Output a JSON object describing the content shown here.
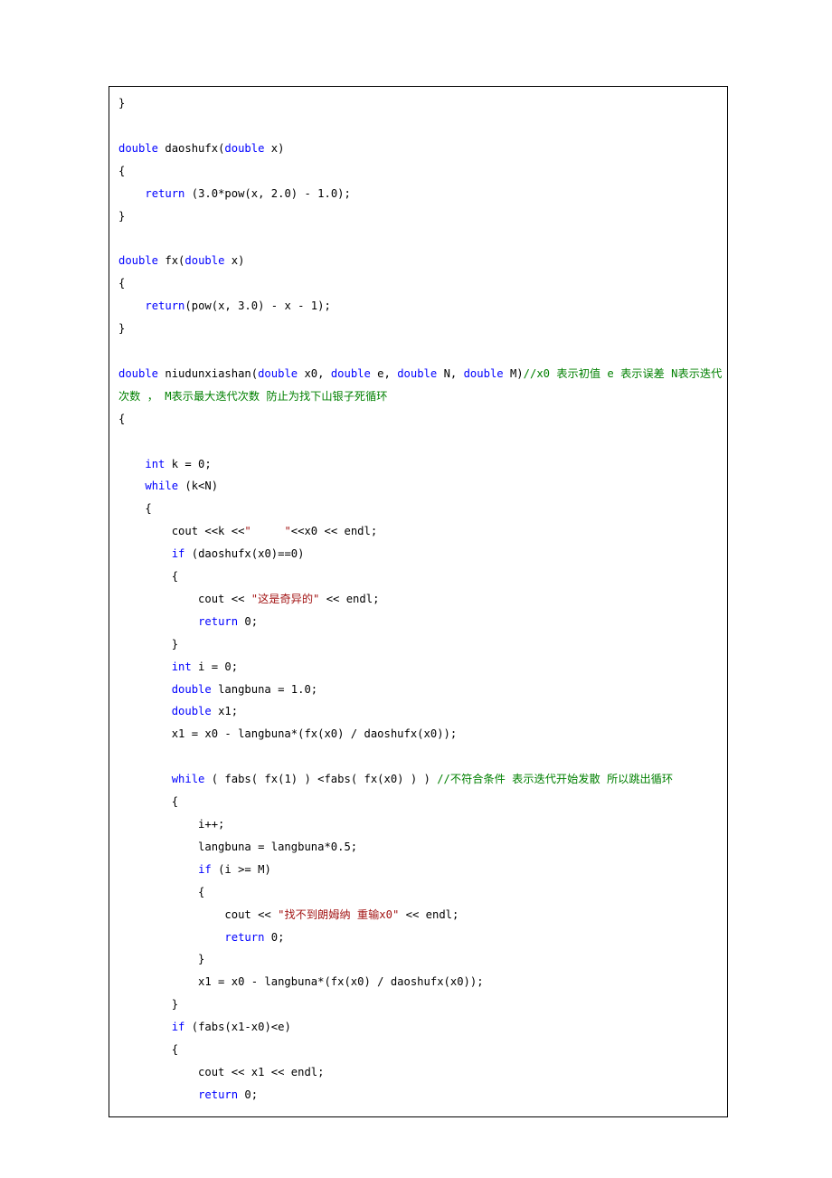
{
  "code": {
    "lines": [
      [
        {
          "t": "}",
          "c": ""
        }
      ],
      [
        {
          "t": "",
          "c": ""
        }
      ],
      [
        {
          "t": "double",
          "c": "kw"
        },
        {
          "t": " daoshufx(",
          "c": ""
        },
        {
          "t": "double",
          "c": "kw"
        },
        {
          "t": " x)",
          "c": ""
        }
      ],
      [
        {
          "t": "{",
          "c": ""
        }
      ],
      [
        {
          "t": "    ",
          "c": ""
        },
        {
          "t": "return",
          "c": "kw"
        },
        {
          "t": " (3.0*pow(x, 2.0) - 1.0);",
          "c": ""
        }
      ],
      [
        {
          "t": "}",
          "c": ""
        }
      ],
      [
        {
          "t": "",
          "c": ""
        }
      ],
      [
        {
          "t": "double",
          "c": "kw"
        },
        {
          "t": " fx(",
          "c": ""
        },
        {
          "t": "double",
          "c": "kw"
        },
        {
          "t": " x)",
          "c": ""
        }
      ],
      [
        {
          "t": "{",
          "c": ""
        }
      ],
      [
        {
          "t": "    ",
          "c": ""
        },
        {
          "t": "return",
          "c": "kw"
        },
        {
          "t": "(pow(x, 3.0) - x - 1);",
          "c": ""
        }
      ],
      [
        {
          "t": "}",
          "c": ""
        }
      ],
      [
        {
          "t": "",
          "c": ""
        }
      ],
      [
        {
          "t": "double",
          "c": "kw"
        },
        {
          "t": " niudunxiashan(",
          "c": ""
        },
        {
          "t": "double",
          "c": "kw"
        },
        {
          "t": " x0, ",
          "c": ""
        },
        {
          "t": "double",
          "c": "kw"
        },
        {
          "t": " e, ",
          "c": ""
        },
        {
          "t": "double",
          "c": "kw"
        },
        {
          "t": " N, ",
          "c": ""
        },
        {
          "t": "double",
          "c": "kw"
        },
        {
          "t": " M)",
          "c": ""
        },
        {
          "t": "//x0 表示初值 e 表示误差 N表示迭代",
          "c": "cm"
        }
      ],
      [
        {
          "t": "次数 ， M表示最大迭代次数 防止为找下山银子死循环",
          "c": "cm"
        }
      ],
      [
        {
          "t": "{",
          "c": ""
        }
      ],
      [
        {
          "t": "",
          "c": ""
        }
      ],
      [
        {
          "t": "    ",
          "c": ""
        },
        {
          "t": "int",
          "c": "kw"
        },
        {
          "t": " k = 0;",
          "c": ""
        }
      ],
      [
        {
          "t": "    ",
          "c": ""
        },
        {
          "t": "while",
          "c": "kw"
        },
        {
          "t": " (k<N)",
          "c": ""
        }
      ],
      [
        {
          "t": "    {",
          "c": ""
        }
      ],
      [
        {
          "t": "        cout <<k <<",
          "c": ""
        },
        {
          "t": "\"     \"",
          "c": "st"
        },
        {
          "t": "<<x0 << endl;",
          "c": ""
        }
      ],
      [
        {
          "t": "        ",
          "c": ""
        },
        {
          "t": "if",
          "c": "kw"
        },
        {
          "t": " (daoshufx(x0)==0)",
          "c": ""
        }
      ],
      [
        {
          "t": "        {",
          "c": ""
        }
      ],
      [
        {
          "t": "            cout << ",
          "c": ""
        },
        {
          "t": "\"这是奇异的\"",
          "c": "st"
        },
        {
          "t": " << endl;",
          "c": ""
        }
      ],
      [
        {
          "t": "            ",
          "c": ""
        },
        {
          "t": "return",
          "c": "kw"
        },
        {
          "t": " 0;",
          "c": ""
        }
      ],
      [
        {
          "t": "        }",
          "c": ""
        }
      ],
      [
        {
          "t": "        ",
          "c": ""
        },
        {
          "t": "int",
          "c": "kw"
        },
        {
          "t": " i = 0;",
          "c": ""
        }
      ],
      [
        {
          "t": "        ",
          "c": ""
        },
        {
          "t": "double",
          "c": "kw"
        },
        {
          "t": " langbuna = 1.0;",
          "c": ""
        }
      ],
      [
        {
          "t": "        ",
          "c": ""
        },
        {
          "t": "double",
          "c": "kw"
        },
        {
          "t": " x1;",
          "c": ""
        }
      ],
      [
        {
          "t": "        x1 = x0 - langbuna*(fx(x0) / daoshufx(x0));",
          "c": ""
        }
      ],
      [
        {
          "t": "",
          "c": ""
        }
      ],
      [
        {
          "t": "        ",
          "c": ""
        },
        {
          "t": "while",
          "c": "kw"
        },
        {
          "t": " ( fabs( fx(1) ) <fabs( fx(x0) ) ) ",
          "c": ""
        },
        {
          "t": "//不符合条件 表示迭代开始发散 所以跳出循环",
          "c": "cm"
        }
      ],
      [
        {
          "t": "        {",
          "c": ""
        }
      ],
      [
        {
          "t": "            i++;",
          "c": ""
        }
      ],
      [
        {
          "t": "            langbuna = langbuna*0.5;",
          "c": ""
        }
      ],
      [
        {
          "t": "            ",
          "c": ""
        },
        {
          "t": "if",
          "c": "kw"
        },
        {
          "t": " (i >= M)",
          "c": ""
        }
      ],
      [
        {
          "t": "            {",
          "c": ""
        }
      ],
      [
        {
          "t": "                cout << ",
          "c": ""
        },
        {
          "t": "\"找不到朗姆纳 重输x0\"",
          "c": "st"
        },
        {
          "t": " << endl;",
          "c": ""
        }
      ],
      [
        {
          "t": "                ",
          "c": ""
        },
        {
          "t": "return",
          "c": "kw"
        },
        {
          "t": " 0;",
          "c": ""
        }
      ],
      [
        {
          "t": "            }",
          "c": ""
        }
      ],
      [
        {
          "t": "            x1 = x0 - langbuna*(fx(x0) / daoshufx(x0));",
          "c": ""
        }
      ],
      [
        {
          "t": "        }",
          "c": ""
        }
      ],
      [
        {
          "t": "        ",
          "c": ""
        },
        {
          "t": "if",
          "c": "kw"
        },
        {
          "t": " (fabs(x1-x0)<e)",
          "c": ""
        }
      ],
      [
        {
          "t": "        {",
          "c": ""
        }
      ],
      [
        {
          "t": "            cout << x1 << endl;",
          "c": ""
        }
      ],
      [
        {
          "t": "            ",
          "c": ""
        },
        {
          "t": "return",
          "c": "kw"
        },
        {
          "t": " 0;",
          "c": ""
        }
      ]
    ]
  }
}
